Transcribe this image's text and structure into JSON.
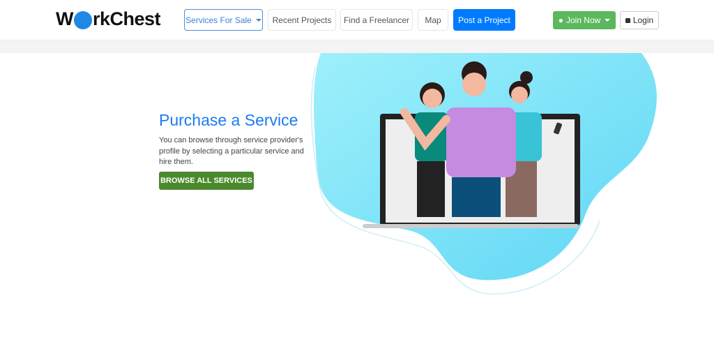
{
  "brand": {
    "logo_text_pre": "W",
    "logo_text_post": "rkChest",
    "logo_full": "WorkChest"
  },
  "nav": {
    "items": [
      {
        "label": "Services For Sale",
        "active": true,
        "dropdown": true
      },
      {
        "label": "Recent Projects"
      },
      {
        "label": "Find a Freelancer"
      },
      {
        "label": "Map"
      },
      {
        "label": "Post a Project",
        "primary": true
      }
    ],
    "join": "Join Now",
    "login": "Login"
  },
  "hero": {
    "title": "Purchase a Service",
    "description": "You can browse through service provider's profile by selecting a particular service and hire them.",
    "button": "BROWSE ALL SERVICES"
  },
  "colors": {
    "primary": "#007bff",
    "success": "#5cb85c",
    "browse": "#4a8a2c",
    "title": "#1a7cf0",
    "blob": "#7fe0f7"
  }
}
